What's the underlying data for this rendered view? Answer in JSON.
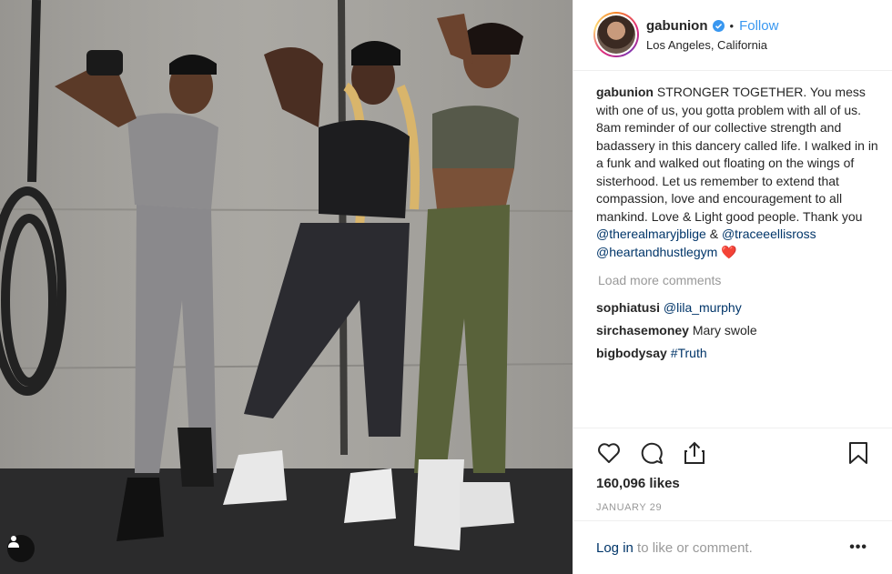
{
  "post": {
    "username": "gabunion",
    "follow_label": "Follow",
    "separator": "•",
    "location": "Los Angeles, California"
  },
  "caption": {
    "username": "gabunion",
    "text": " STRONGER TOGETHER. You mess with one of us, you gotta problem with all of us. 8am reminder of our collective strength and badassery in this dancery called life. I walked in in a funk and walked out floating on the wings of sisterhood. Let us remember to extend that compassion, love and encouragement to all mankind. Love & Light good people. Thank you ",
    "mention1": "@therealmaryjblige",
    "amp": " & ",
    "mention2": "@traceeellisross",
    "mention3": "@heartandhustlegym",
    "heart": " ❤️"
  },
  "load_more": "Load more comments",
  "comments": [
    {
      "user": "sophiatusi",
      "text": "@lila_murphy"
    },
    {
      "user": "sirchasemoney",
      "text": "Mary swole"
    },
    {
      "user": "bigbodysay",
      "text": "#Truth"
    }
  ],
  "likes": "160,096 likes",
  "date": "JANUARY 29",
  "login": {
    "link": "Log in",
    "rest": " to like or comment."
  },
  "more": "•••",
  "colors": {
    "accent": "#3897f0",
    "link": "#003569",
    "muted": "#999999",
    "heart": "#ed4956"
  },
  "icons": [
    "heart-icon",
    "comment-icon",
    "share-icon",
    "bookmark-icon",
    "verified-badge-icon",
    "user-tag-icon"
  ]
}
